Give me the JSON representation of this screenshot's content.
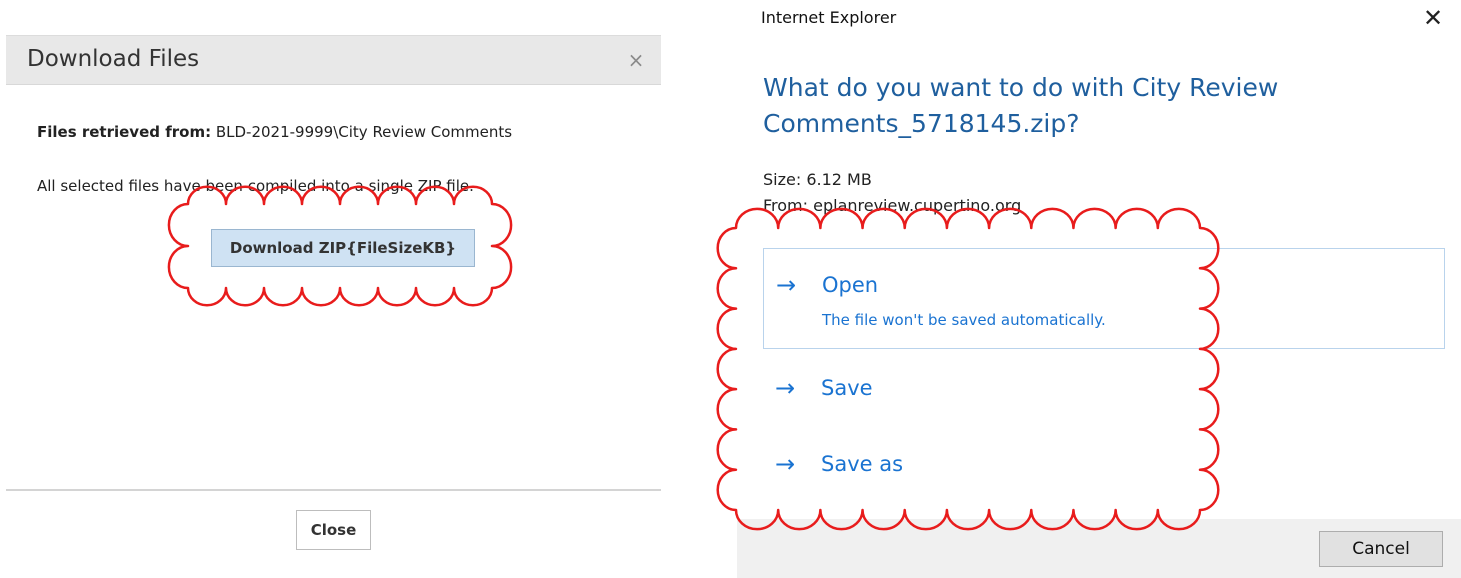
{
  "left_dialog": {
    "title": "Download Files",
    "close_glyph": "×",
    "files_label": "Files retrieved from:",
    "files_value": " BLD-2021-9999\\City Review Comments",
    "compiled_text": "All selected files have been compiled into a single ZIP file.",
    "download_button": "Download ZIP{FileSizeKB}",
    "close_button": "Close"
  },
  "ie_dialog": {
    "title": "Internet Explorer",
    "close_glyph": "✕",
    "question": "What do you want to do with City Review Comments_5718145.zip?",
    "size": "Size: 6.12 MB",
    "from": "From: eplanreview.cupertino.org",
    "options": [
      {
        "arrow": "→",
        "label": "Open",
        "sub": "The file won't be saved automatically."
      },
      {
        "arrow": "→",
        "label": "Save"
      },
      {
        "arrow": "→",
        "label": "Save as"
      }
    ],
    "cancel_button": "Cancel"
  },
  "annotations": {
    "cloud_color": "#e81c1c"
  },
  "colors": {
    "ie_link": "#1a73d1",
    "ie_heading": "#1f5f9e",
    "download_button_bg": "#cfe2f3"
  }
}
